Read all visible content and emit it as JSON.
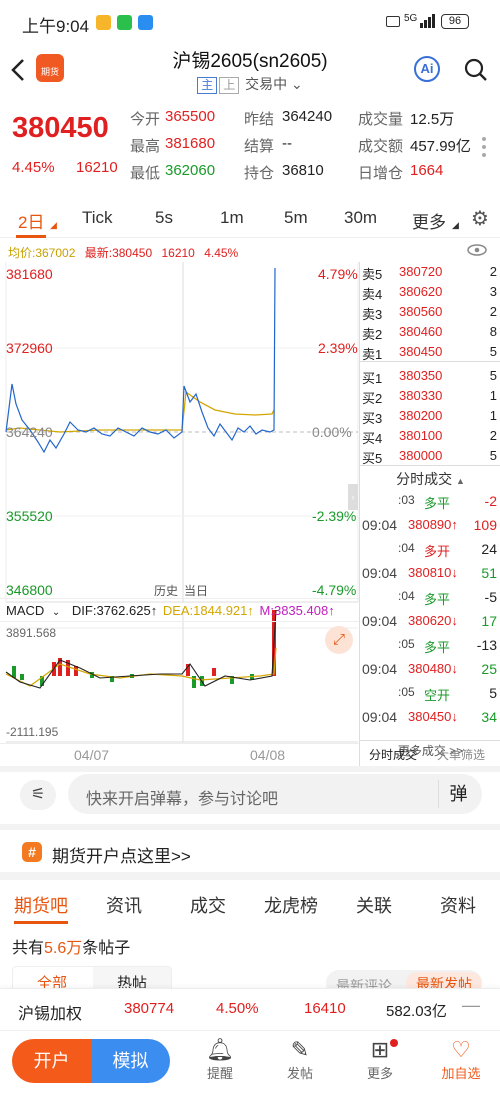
{
  "status_bar": {
    "time": "上午9:04",
    "network": "5G",
    "battery": "96"
  },
  "header": {
    "title": "沪锡2605(sn2605)",
    "tag_main": "主",
    "tag_up": "上",
    "trading_status": "交易中",
    "ai_label": "Ai"
  },
  "quote": {
    "last": "380450",
    "change_pct": "4.45%",
    "change": "16210",
    "rows": [
      [
        {
          "k": "今开",
          "v": "365500",
          "c": "red"
        },
        {
          "k": "昨结",
          "v": "364240",
          "c": "black"
        },
        {
          "k": "成交量",
          "v": "12.5万",
          "c": "black"
        }
      ],
      [
        {
          "k": "最高",
          "v": "381680",
          "c": "red"
        },
        {
          "k": "结算",
          "v": "--",
          "c": "black"
        },
        {
          "k": "成交额",
          "v": "457.99亿",
          "c": "black"
        }
      ],
      [
        {
          "k": "最低",
          "v": "362060",
          "c": "green"
        },
        {
          "k": "持仓",
          "v": "36810",
          "c": "black"
        },
        {
          "k": "日增仓",
          "v": "1664",
          "c": "red"
        }
      ]
    ]
  },
  "period_tabs": [
    "2日",
    "Tick",
    "5s",
    "1m",
    "5m",
    "30m",
    "更多"
  ],
  "chart": {
    "info_avg": "均价:367002",
    "info_last": "最新:380450",
    "info_change": "16210",
    "info_pct": "4.45%",
    "price_labels": [
      "381680",
      "372960",
      "364240",
      "355520",
      "346800"
    ],
    "pct_labels": [
      "4.79%",
      "2.39%",
      "0.00%",
      "-2.39%",
      "-4.79%"
    ],
    "history_label": "历史",
    "today_label": "当日",
    "macd_label": "MACD",
    "dif": "DIF:3762.625↑",
    "dea": "DEA:1844.921↑",
    "m": "M:3835.408↑",
    "macd_top": "3891.568",
    "macd_bottom": "-2111.195",
    "dates": [
      "04/07",
      "04/08"
    ]
  },
  "orderbook": {
    "asks": [
      {
        "label": "卖5",
        "price": "380720",
        "vol": "2"
      },
      {
        "label": "卖4",
        "price": "380620",
        "vol": "3"
      },
      {
        "label": "卖3",
        "price": "380560",
        "vol": "2"
      },
      {
        "label": "卖2",
        "price": "380460",
        "vol": "8"
      },
      {
        "label": "卖1",
        "price": "380450",
        "vol": "5"
      }
    ],
    "bids": [
      {
        "label": "买1",
        "price": "380350",
        "vol": "5"
      },
      {
        "label": "买2",
        "price": "380330",
        "vol": "1"
      },
      {
        "label": "买3",
        "price": "380200",
        "vol": "1"
      },
      {
        "label": "买4",
        "price": "380100",
        "vol": "2"
      },
      {
        "label": "买5",
        "price": "380000",
        "vol": "5"
      }
    ]
  },
  "trades": {
    "title": "分时成交",
    "items": [
      {
        "time": ":03",
        "price": "多平",
        "pc": "green",
        "vol": "-2",
        "vc": "red"
      },
      {
        "time": "09:04",
        "price": "380890↑",
        "pc": "red",
        "vol": "109",
        "vc": "red"
      },
      {
        "time": ":04",
        "price": "多开",
        "pc": "red",
        "vol": "24",
        "vc": "black"
      },
      {
        "time": "09:04",
        "price": "380810↓",
        "pc": "red",
        "vol": "51",
        "vc": "green"
      },
      {
        "time": ":04",
        "price": "多平",
        "pc": "green",
        "vol": "-5",
        "vc": "black"
      },
      {
        "time": "09:04",
        "price": "380620↓",
        "pc": "red",
        "vol": "17",
        "vc": "green"
      },
      {
        "time": ":05",
        "price": "多平",
        "pc": "green",
        "vol": "-13",
        "vc": "black"
      },
      {
        "time": "09:04",
        "price": "380480↓",
        "pc": "red",
        "vol": "25",
        "vc": "green"
      },
      {
        "time": ":05",
        "price": "空开",
        "pc": "green",
        "vol": "5",
        "vc": "black"
      },
      {
        "time": "09:04",
        "price": "380450↓",
        "pc": "red",
        "vol": "34",
        "vc": "green"
      }
    ],
    "more": "更多成交 >>",
    "tab1": "分时成交",
    "tab2": "大单筛选"
  },
  "comment": {
    "placeholder": "快来开启弹幕，参与讨论吧",
    "send": "弹"
  },
  "open_account": "期货开户点这里>>",
  "content_tabs": [
    "期货吧",
    "资讯",
    "成交",
    "龙虎榜",
    "关联",
    "资料"
  ],
  "post_count": {
    "prefix": "共有",
    "count": "5.6万",
    "suffix": "条帖子"
  },
  "filter": {
    "all": "全部",
    "hot": "热帖",
    "latest_comment": "最新评论",
    "latest_post": "最新发帖"
  },
  "ticker": {
    "name": "沪锡加权",
    "price": "380774",
    "pct": "4.50%",
    "change": "16410",
    "amount": "582.03亿"
  },
  "bottom_nav": {
    "open": "开户",
    "sim": "模拟",
    "items": [
      "提醒",
      "发帖",
      "更多",
      "加自选"
    ]
  },
  "colors": {
    "red": "#e02020",
    "green": "#1a9a2a",
    "orange": "#f47a22",
    "blue": "#3b82f6"
  }
}
